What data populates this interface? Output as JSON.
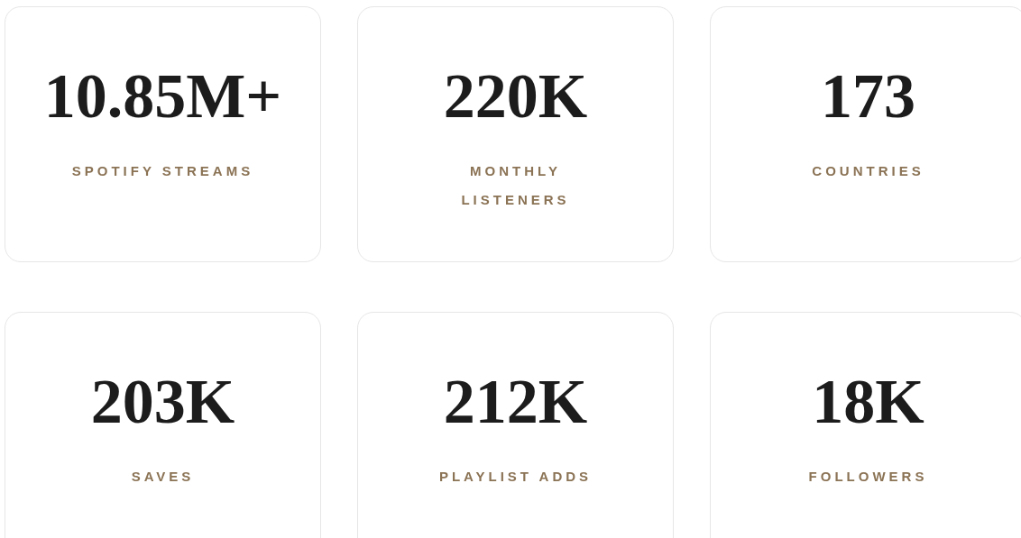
{
  "stats": [
    {
      "value": "10.85M+",
      "label": "SPOTIFY STREAMS"
    },
    {
      "value": "220K",
      "label": "MONTHLY LISTENERS"
    },
    {
      "value": "173",
      "label": "COUNTRIES"
    },
    {
      "value": "203K",
      "label": "SAVES"
    },
    {
      "value": "212K",
      "label": "PLAYLIST ADDS"
    },
    {
      "value": "18K",
      "label": "FOLLOWERS"
    }
  ]
}
